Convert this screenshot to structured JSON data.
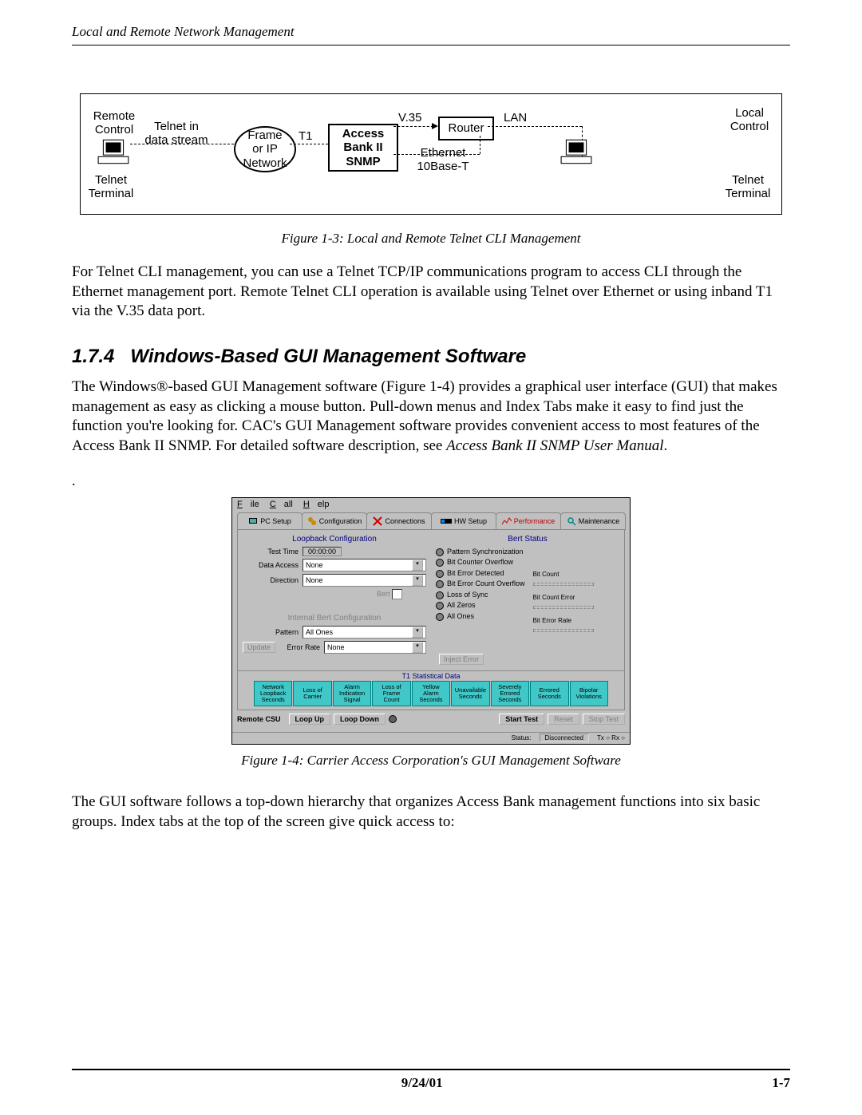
{
  "header": "Local and Remote Network Management",
  "diagram": {
    "remote_control": "Remote\nControl",
    "telnet_terminal_l": "Telnet\nTerminal",
    "telnet_stream": "Telnet in\ndata stream",
    "frame_ip": "Frame\nor IP\nNetwork",
    "t1": "T1",
    "access_bank": "Access\nBank II\nSNMP",
    "v35": "V.35",
    "router": "Router",
    "ethernet": "Ethernet\n10Base-T",
    "lan": "LAN",
    "local_control": "Local\nControl",
    "telnet_terminal_r": "Telnet\nTerminal"
  },
  "fig13_caption": "Figure 1-3: Local and Remote Telnet CLI Management",
  "para1": "For Telnet CLI management, you can use a Telnet TCP/IP communications program to access CLI through the Ethernet management port. Remote Telnet CLI operation is available using Telnet over Ethernet or using inband T1 via the V.35 data port.",
  "section_num": "1.7.4",
  "section_title": "Windows-Based GUI Management Software",
  "para2a": "The Windows®-based GUI Management software (Figure 1-4) provides a graphical user interface (GUI) that makes management as easy as clicking a mouse button. Pull-down menus and Index Tabs make it easy to find just the function you're looking for. CAC's GUI Management software provides convenient access to most features of the Access Bank II SNMP. For detailed software description, see ",
  "para2b": "Access Bank II SNMP User Manual",
  "para2c": ".",
  "gui": {
    "menu": {
      "file": "File",
      "call": "Call",
      "help": "Help"
    },
    "tabs": [
      "PC Setup",
      "Configuration",
      "Connections",
      "HW Setup",
      "Performance",
      "Maintenance"
    ],
    "loopback_title": "Loopback Configuration",
    "test_time_label": "Test Time",
    "test_time_value": "00:00:00",
    "data_access_label": "Data Access",
    "data_access_value": "None",
    "direction_label": "Direction",
    "direction_value": "None",
    "bert_checkbox_label": "Bert",
    "ibc_title": "Internal Bert Configuration",
    "pattern_label": "Pattern",
    "pattern_value": "All Ones",
    "error_rate_label": "Error Rate",
    "error_rate_value": "None",
    "update_btn": "Update",
    "bert_status_title": "Bert Status",
    "status_items": [
      "Pattern Synchronization",
      "Bit Counter Overflow",
      "Bit Error Detected",
      "Bit Error Count Overflow",
      "Loss of Sync",
      "All Zeros",
      "All Ones"
    ],
    "bit_count": "Bit Count",
    "bit_count_error": "Bit Count Error",
    "bit_error_rate": "Bit Error Rate",
    "inject_error_btn": "Inject Error",
    "t1_title": "T1 Statistical Data",
    "t1_cells": [
      "Network\nLoopback\nSeconds",
      "Loss of\nCarrier",
      "Alarm\nIndication\nSignal",
      "Loss of\nFrame\nCount",
      "Yellow\nAlarm\nSeconds",
      "Unavailable\nSeconds",
      "Severely\nErrored\nSeconds",
      "Errored\nSeconds",
      "Bipolar\nViolations"
    ],
    "remote_csu": "Remote CSU",
    "loop_up": "Loop Up",
    "loop_down": "Loop Down",
    "start_test": "Start Test",
    "reset": "Reset",
    "stop_test": "Stop Test",
    "status_label": "Status:",
    "status_value": "Disconnected",
    "txrx": "Tx ○ Rx ○"
  },
  "fig14_caption": "Figure 1-4: Carrier Access Corporation's GUI Management Software",
  "para3": "The GUI software follows a top-down hierarchy that organizes Access Bank management functions into six basic groups. Index tabs at the top of the screen give quick access to:",
  "footer_date": "9/24/01",
  "footer_page": "1-7"
}
